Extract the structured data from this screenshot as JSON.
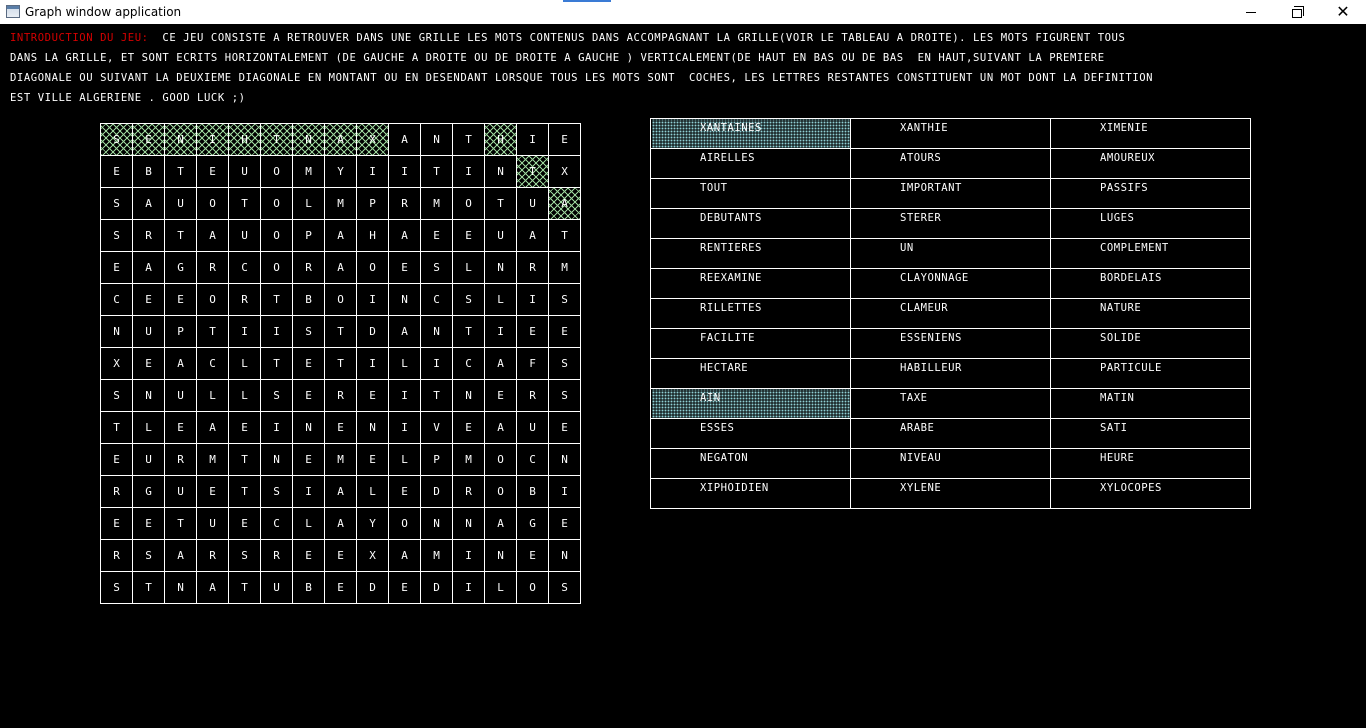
{
  "window": {
    "title": "Graph window application",
    "minimize_glyph": "",
    "maximize_glyph": "",
    "close_glyph": "✕"
  },
  "intro": {
    "label": "INTRODUCTION DU JEU:",
    "line1": "  CE JEU CONSISTE A RETROUVER DANS UNE GRILLE LES MOTS CONTENUS DANS ACCOMPAGNANT LA GRILLE(VOIR LE TABLEAU A DROITE). LES MOTS FIGURENT TOUS",
    "line2": "DANS LA GRILLE, ET SONT ECRITS HORIZONTALEMENT (DE GAUCHE A DROITE OU DE DROITE A GAUCHE ) VERTICALEMENT(DE HAUT EN BAS OU DE BAS  EN HAUT,SUIVANT LA PREMIERE",
    "line3": "DIAGONALE OU SUIVANT LA DEUXIEME DIAGONALE EN MONTANT OU EN DESENDANT LORSQUE TOUS LES MOTS SONT  COCHES, LES LETTRES RESTANTES CONSTITUENT UN MOT DONT LA DEFINITION",
    "line4": "EST VILLE ALGERIENE . GOOD LUCK ;)"
  },
  "grid": {
    "rows": [
      [
        "S",
        "E",
        "N",
        "I",
        "H",
        "T",
        "N",
        "A",
        "X",
        "A",
        "N",
        "T",
        "H",
        "I",
        "E"
      ],
      [
        "E",
        "B",
        "T",
        "E",
        "U",
        "O",
        "M",
        "Y",
        "I",
        "I",
        "T",
        "I",
        "N",
        "T",
        "X"
      ],
      [
        "S",
        "A",
        "U",
        "O",
        "T",
        "O",
        "L",
        "M",
        "P",
        "R",
        "M",
        "O",
        "T",
        "U",
        "A"
      ],
      [
        "S",
        "R",
        "T",
        "A",
        "U",
        "O",
        "P",
        "A",
        "H",
        "A",
        "E",
        "E",
        "U",
        "A",
        "T"
      ],
      [
        "E",
        "A",
        "G",
        "R",
        "C",
        "O",
        "R",
        "A",
        "O",
        "E",
        "S",
        "L",
        "N",
        "R",
        "M"
      ],
      [
        "C",
        "E",
        "E",
        "O",
        "R",
        "T",
        "B",
        "O",
        "I",
        "N",
        "C",
        "S",
        "L",
        "I",
        "S"
      ],
      [
        "N",
        "U",
        "P",
        "T",
        "I",
        "I",
        "S",
        "T",
        "D",
        "A",
        "N",
        "T",
        "I",
        "E",
        "E"
      ],
      [
        "X",
        "E",
        "A",
        "C",
        "L",
        "T",
        "E",
        "T",
        "I",
        "L",
        "I",
        "C",
        "A",
        "F",
        "S"
      ],
      [
        "S",
        "N",
        "U",
        "L",
        "L",
        "S",
        "E",
        "R",
        "E",
        "I",
        "T",
        "N",
        "E",
        "R",
        "S"
      ],
      [
        "T",
        "L",
        "E",
        "A",
        "E",
        "I",
        "N",
        "E",
        "N",
        "I",
        "V",
        "E",
        "A",
        "U",
        "E"
      ],
      [
        "E",
        "U",
        "R",
        "M",
        "T",
        "N",
        "E",
        "M",
        "E",
        "L",
        "P",
        "M",
        "O",
        "C",
        "N"
      ],
      [
        "R",
        "G",
        "U",
        "E",
        "T",
        "S",
        "I",
        "A",
        "L",
        "E",
        "D",
        "R",
        "O",
        "B",
        "I"
      ],
      [
        "E",
        "E",
        "T",
        "U",
        "E",
        "C",
        "L",
        "A",
        "Y",
        "O",
        "N",
        "N",
        "A",
        "G",
        "E"
      ],
      [
        "R",
        "S",
        "A",
        "R",
        "S",
        "R",
        "E",
        "E",
        "X",
        "A",
        "M",
        "I",
        "N",
        "E",
        "N"
      ],
      [
        "S",
        "T",
        "N",
        "A",
        "T",
        "U",
        "B",
        "E",
        "D",
        "E",
        "D",
        "I",
        "L",
        "O",
        "S"
      ]
    ],
    "highlighted": [
      [
        0,
        0
      ],
      [
        0,
        1
      ],
      [
        0,
        2
      ],
      [
        0,
        3
      ],
      [
        0,
        4
      ],
      [
        0,
        5
      ],
      [
        0,
        6
      ],
      [
        0,
        7
      ],
      [
        0,
        8
      ],
      [
        0,
        12
      ],
      [
        1,
        13
      ],
      [
        2,
        14
      ]
    ]
  },
  "words": {
    "rows": [
      [
        "XANTAINES",
        "XANTHIE",
        "XIMENIE"
      ],
      [
        "AIRELLES",
        "ATOURS",
        "AMOUREUX"
      ],
      [
        "TOUT",
        "IMPORTANT",
        "PASSIFS"
      ],
      [
        "DEBUTANTS",
        "STERER",
        "LUGES"
      ],
      [
        "RENTIERES",
        "UN",
        "COMPLEMENT"
      ],
      [
        "REEXAMINE",
        "CLAYONNAGE",
        "BORDELAIS"
      ],
      [
        "RILLETTES",
        "CLAMEUR",
        "NATURE"
      ],
      [
        "FACILITE",
        "ESSENIENS",
        "SOLIDE"
      ],
      [
        "HECTARE",
        "HABILLEUR",
        "PARTICULE"
      ],
      [
        "AIN",
        "TAXE",
        "MATIN"
      ],
      [
        "ESSES",
        "ARABE",
        "SATI"
      ],
      [
        "NEGATON",
        "NIVEAU",
        "HEURE"
      ],
      [
        "XIPHOIDIEN",
        "XYLENE",
        "XYLOCOPES"
      ]
    ],
    "found": [
      [
        0,
        0
      ],
      [
        9,
        0
      ]
    ]
  },
  "colors": {
    "background": "#000000",
    "intro_label": "#d40000",
    "grid_hit": "#9bd49b",
    "word_found": "#8fd0d6"
  }
}
